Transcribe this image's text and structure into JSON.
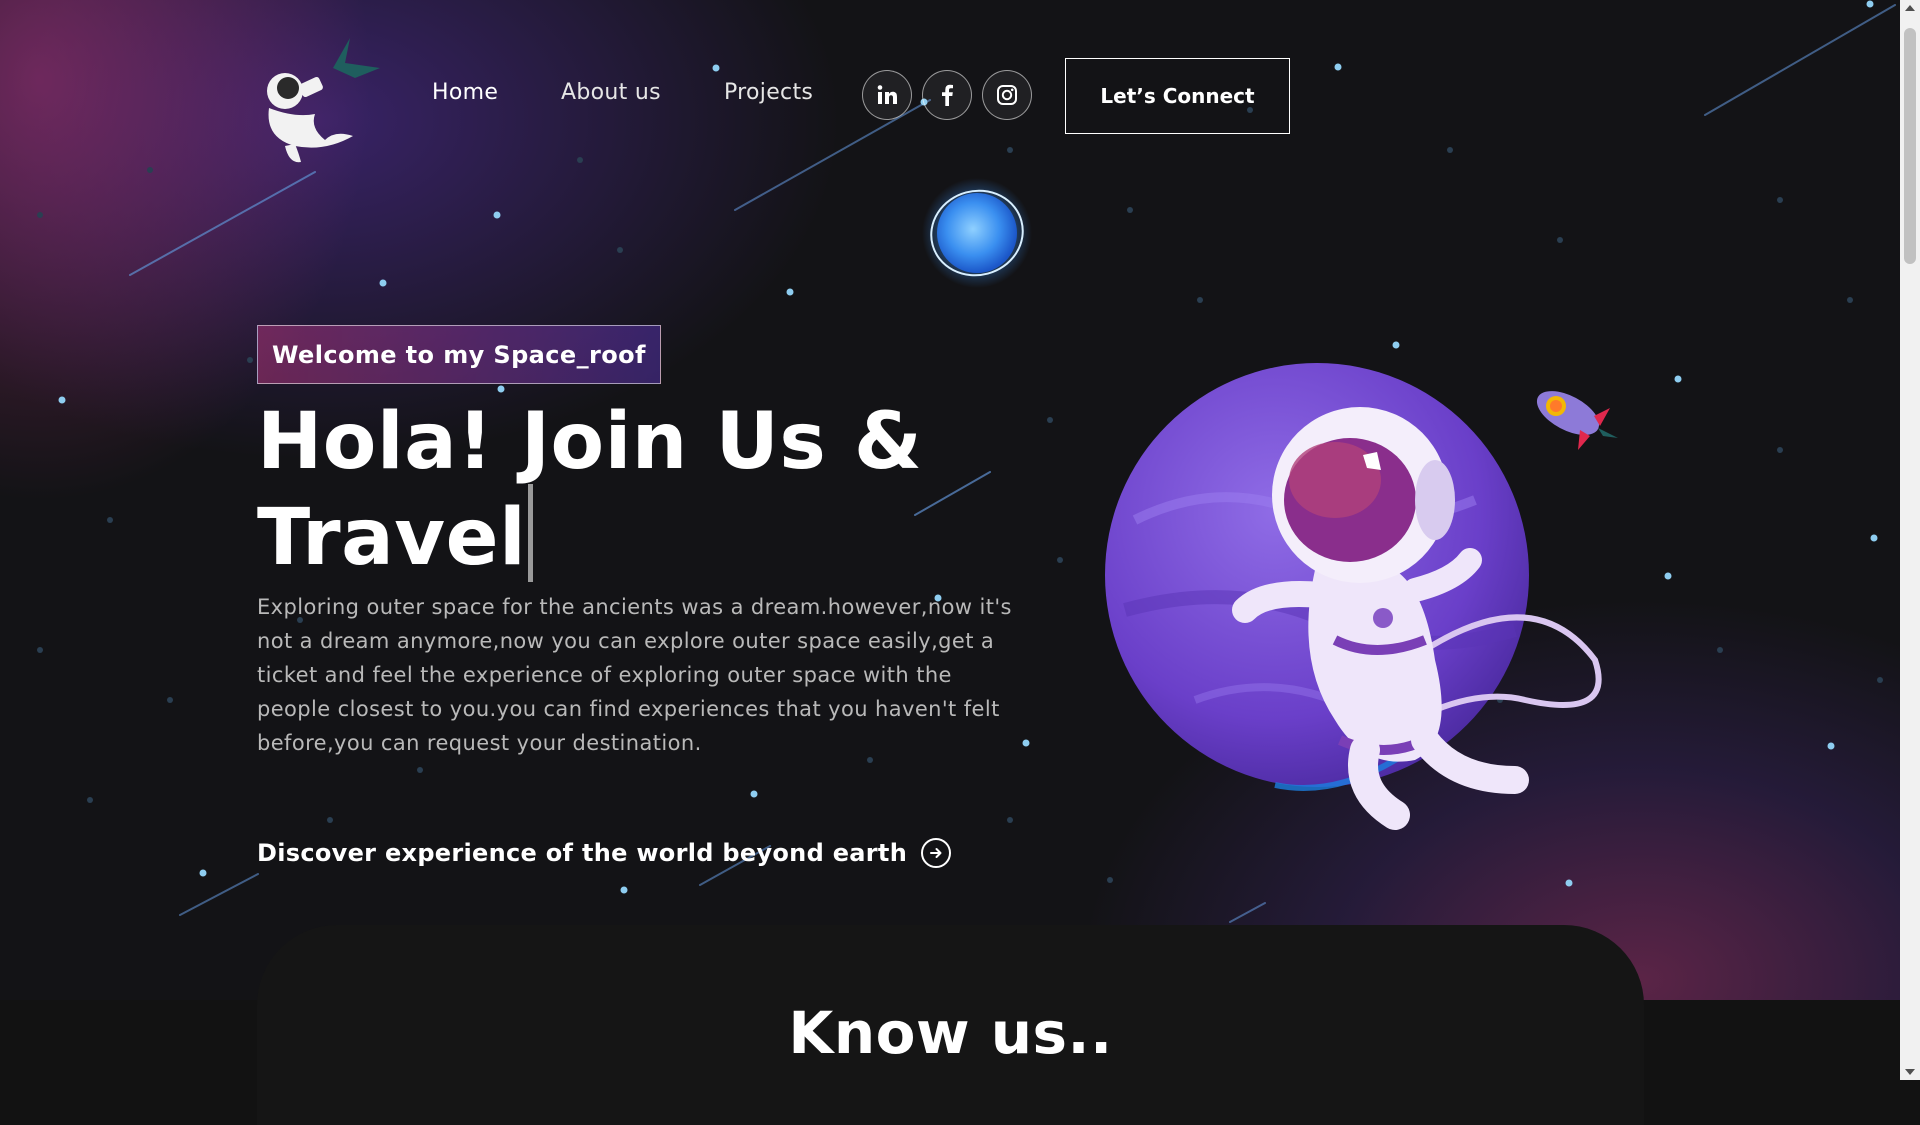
{
  "nav": {
    "links": [
      "Home",
      "About us",
      "Projects"
    ],
    "social_icons": [
      "linkedin-icon",
      "facebook-icon",
      "instagram-icon"
    ],
    "cta_label": "Let’s Connect"
  },
  "hero": {
    "tagline": "Welcome to my Space_roof",
    "headline_line1": "Hola! Join Us &",
    "headline_line2": "Travel",
    "description": "Exploring outer space for the ancients was a dream.however,now it's not a dream anymore,now you can explore outer space easily,get a ticket and feel the experience of exploring outer space with the people closest to you.you can find experiences that you haven't felt before,you can request your destination.",
    "discover_label": "Discover experience of the world beyond earth",
    "discover_icon": "arrow-right-circle-icon"
  },
  "know_us": {
    "title": "Know us.."
  },
  "colors": {
    "background": "#121212",
    "tagline_gradient_start": "#aa3478",
    "tagline_gradient_end": "#5834b4",
    "planet": "#7a4fd6",
    "star": "#8ecdf0"
  }
}
